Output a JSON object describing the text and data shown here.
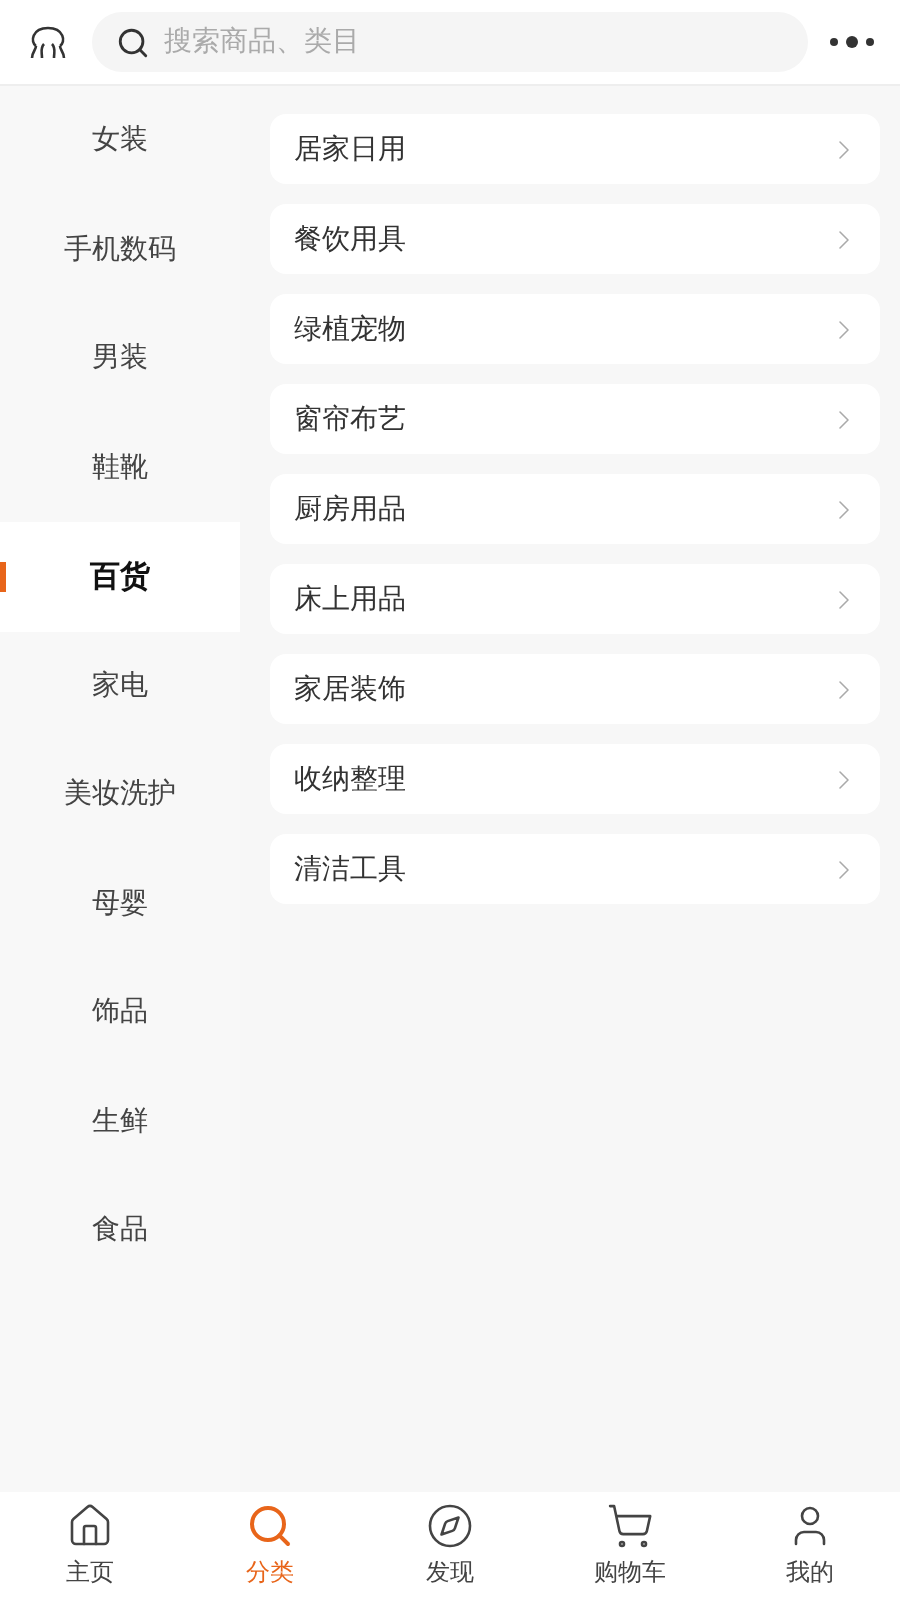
{
  "search": {
    "placeholder": "搜索商品、类目"
  },
  "sidebar": {
    "items": [
      {
        "label": "女装",
        "selected": false
      },
      {
        "label": "手机数码",
        "selected": false
      },
      {
        "label": "男装",
        "selected": false
      },
      {
        "label": "鞋靴",
        "selected": false
      },
      {
        "label": "百货",
        "selected": true
      },
      {
        "label": "家电",
        "selected": false
      },
      {
        "label": "美妆洗护",
        "selected": false
      },
      {
        "label": "母婴",
        "selected": false
      },
      {
        "label": "饰品",
        "selected": false
      },
      {
        "label": "生鲜",
        "selected": false
      },
      {
        "label": "食品",
        "selected": false
      }
    ]
  },
  "subcategories": [
    "居家日用",
    "餐饮用具",
    "绿植宠物",
    "窗帘布艺",
    "厨房用品",
    "床上用品",
    "家居装饰",
    "收纳整理",
    "清洁工具"
  ],
  "tab_bar": [
    {
      "kind": "home",
      "label": "主页",
      "selected": false
    },
    {
      "kind": "category",
      "label": "分类",
      "selected": true
    },
    {
      "kind": "discover",
      "label": "发现",
      "selected": false
    },
    {
      "kind": "cart",
      "label": "购物车",
      "selected": false
    },
    {
      "kind": "profile",
      "label": "我的",
      "selected": false
    }
  ]
}
